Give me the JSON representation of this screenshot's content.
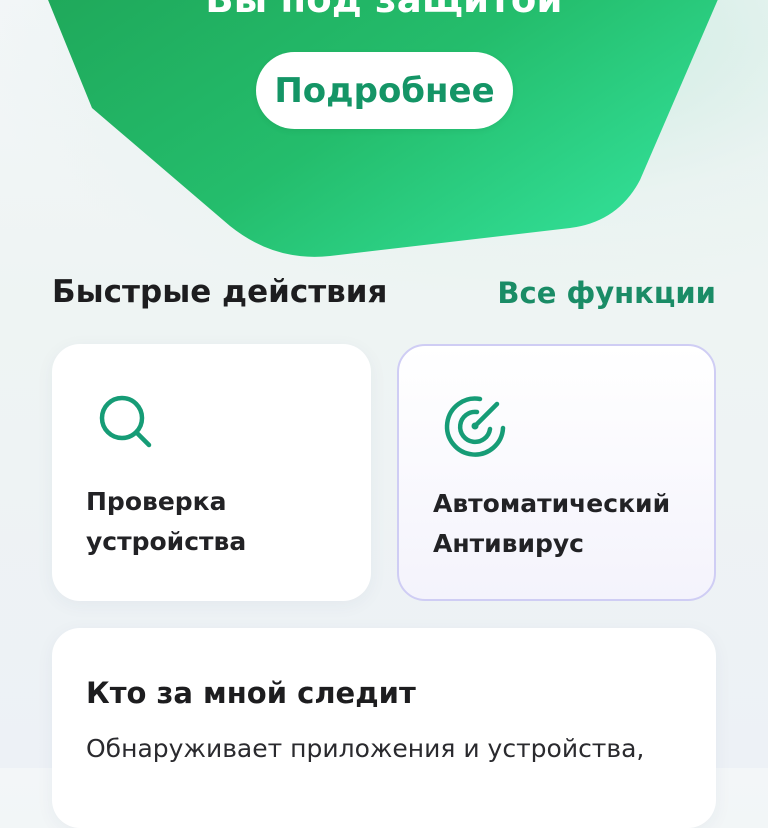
{
  "hero": {
    "status_title": "Вы под защитой",
    "details_label": "Подробнее",
    "colors": {
      "green_light": "#2fd38c",
      "green_dark": "#1aa65a",
      "button_text": "#149566"
    }
  },
  "quick_actions": {
    "title": "Быстрые действия",
    "all_features_label": "Все функции",
    "items": [
      {
        "icon": "search-icon",
        "line1": "Проверка",
        "line2": "устройства"
      },
      {
        "icon": "radar-icon",
        "line1": "Автоматический",
        "line2": "Антивирус"
      }
    ]
  },
  "tracker_card": {
    "title": "Кто за мной следит",
    "description": "Обнаруживает приложения и устройства,"
  }
}
